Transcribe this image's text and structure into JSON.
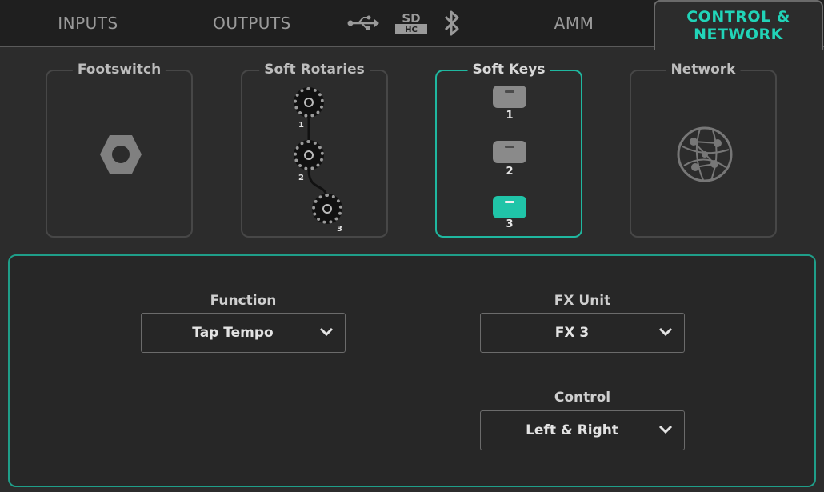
{
  "tabs": {
    "inputs": "INPUTS",
    "outputs": "OUTPUTS",
    "amm": "AMM",
    "control_line1": "CONTROL &",
    "control_line2": "NETWORK",
    "icons": [
      "usb-icon",
      "sdhc-icon",
      "bluetooth-icon"
    ]
  },
  "devices": {
    "footswitch": {
      "title": "Footswitch",
      "icon": "footswitch-jack-icon"
    },
    "soft_rotaries": {
      "title": "Soft Rotaries",
      "labels": [
        "1",
        "2",
        "3"
      ]
    },
    "soft_keys": {
      "title": "Soft Keys",
      "labels": [
        "1",
        "2",
        "3"
      ],
      "selected_key": "3"
    },
    "network": {
      "title": "Network",
      "icon": "network-globe-icon"
    }
  },
  "settings": {
    "function": {
      "label": "Function",
      "value": "Tap Tempo"
    },
    "fx_unit": {
      "label": "FX Unit",
      "value": "FX 3"
    },
    "control": {
      "label": "Control",
      "value": "Left & Right"
    }
  },
  "colors": {
    "accent": "#21d4b8",
    "selected_border": "#1fb8a0",
    "background": "#2c2c2c"
  }
}
